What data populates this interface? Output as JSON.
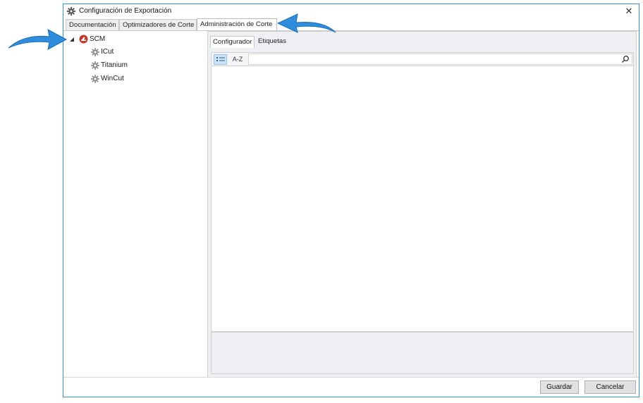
{
  "window": {
    "title": "Configuración de Exportación",
    "close_glyph": "✕"
  },
  "tabs": [
    {
      "label": "Documentación"
    },
    {
      "label": "Optimizadores de Corte"
    },
    {
      "label": "Administración de Corte",
      "active": true
    }
  ],
  "tree": {
    "root": {
      "label": "SCM",
      "icon": "scm-logo-icon",
      "expanded": true
    },
    "children": [
      {
        "label": "ICut",
        "icon": "gear-icon"
      },
      {
        "label": "Titanium",
        "icon": "gear-icon"
      },
      {
        "label": "WinCut",
        "icon": "gear-icon"
      }
    ]
  },
  "panel": {
    "subtabs": [
      {
        "label": "Configurador",
        "active": true
      },
      {
        "label": "Etiquetas"
      }
    ],
    "toolbar": {
      "categorized_icon": "categorized-list-icon",
      "alpha_label": "A-Z",
      "search_icon": "search-icon"
    }
  },
  "buttons": {
    "save": "Guardar",
    "cancel": "Cancelar"
  },
  "colors": {
    "arrow": "#2f8ddb",
    "window_border": "#3b8fd6",
    "scm_logo": "#c0392b"
  }
}
